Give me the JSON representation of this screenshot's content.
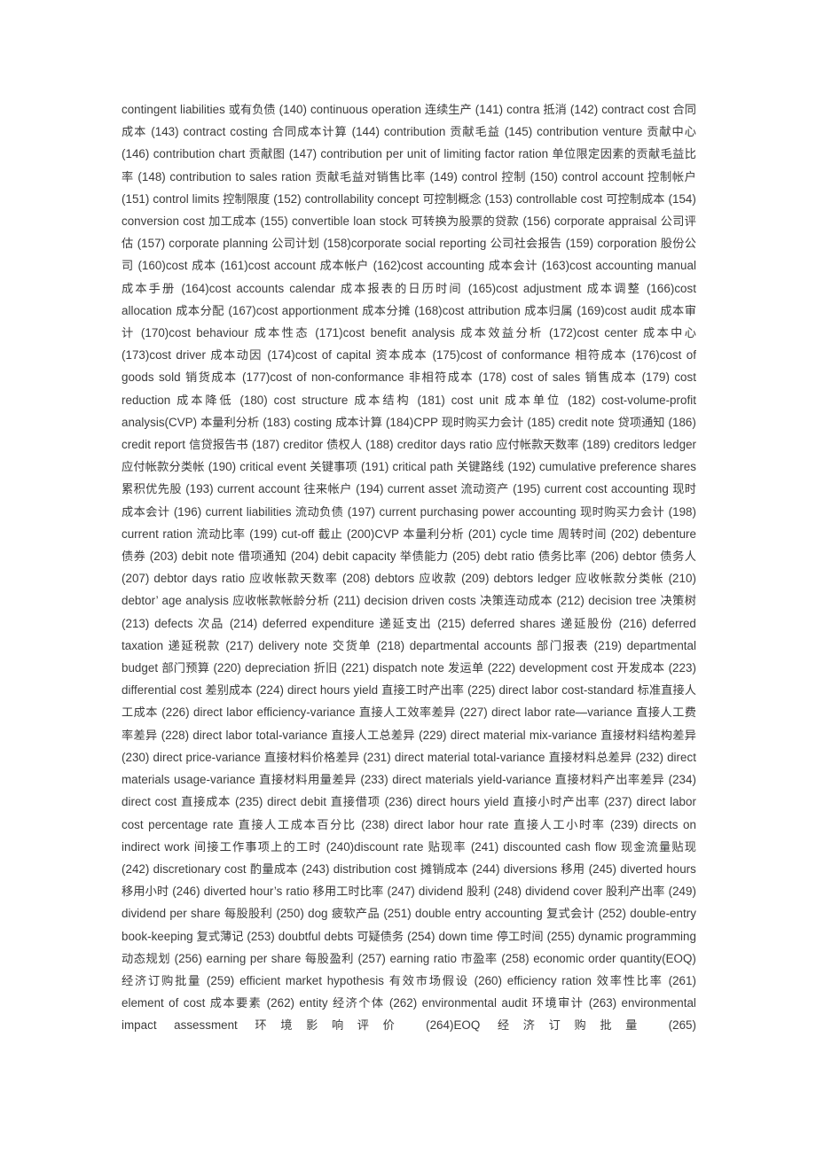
{
  "document": {
    "page_background": "#ffffff",
    "text_color": "#3b3b3b",
    "kind": "bilingual-glossary-page",
    "entry_range": "140-265",
    "entries": [
      {
        "num": "",
        "en": "contingent liabilities",
        "zh": "或有负债"
      },
      {
        "num": "(140)",
        "en": "continuous operation",
        "zh": "连续生产"
      },
      {
        "num": "(141)",
        "en": "contra",
        "zh": "抵消"
      },
      {
        "num": "(142)",
        "en": "contract cost",
        "zh": "合同成本"
      },
      {
        "num": "(143)",
        "en": "contract costing",
        "zh": "合同成本计算"
      },
      {
        "num": "(144)",
        "en": "contribution",
        "zh": "贡献毛益"
      },
      {
        "num": "(145)",
        "en": "contribution venture",
        "zh": "贡献中心"
      },
      {
        "num": "(146)",
        "en": "contribution chart",
        "zh": "贡献图"
      },
      {
        "num": "(147)",
        "en": "contribution per unit of limiting factor ration",
        "zh": "单位限定因素的贡献毛益比率"
      },
      {
        "num": "(148)",
        "en": "contribution to sales ration",
        "zh": "贡献毛益对销售比率"
      },
      {
        "num": "(149)",
        "en": "control",
        "zh": "控制"
      },
      {
        "num": "(150)",
        "en": "control account",
        "zh": "控制帐户"
      },
      {
        "num": "(151)",
        "en": "control limits",
        "zh": "控制限度"
      },
      {
        "num": "(152)",
        "en": "controllability concept",
        "zh": "可控制概念"
      },
      {
        "num": "(153)",
        "en": "controllable cost",
        "zh": "可控制成本"
      },
      {
        "num": "(154)",
        "en": "conversion cost",
        "zh": "加工成本"
      },
      {
        "num": "(155)",
        "en": "convertible loan stock",
        "zh": "可转换为股票的贷款"
      },
      {
        "num": "(156)",
        "en": "corporate appraisal",
        "zh": "公司评估"
      },
      {
        "num": "(157)",
        "en": "corporate planning",
        "zh": "公司计划"
      },
      {
        "num": "(158)",
        "en": "corporate social reporting",
        "zh": "公司社会报告",
        "tight": true
      },
      {
        "num": "(159)",
        "en": "corporation",
        "zh": "股份公司"
      },
      {
        "num": "(160)",
        "en": "cost",
        "zh": "成本",
        "tight": true
      },
      {
        "num": "(161)",
        "en": "cost account",
        "zh": "成本帐户",
        "tight": true
      },
      {
        "num": "(162)",
        "en": "cost accounting",
        "zh": "成本会计",
        "tight": true
      },
      {
        "num": "(163)",
        "en": "cost accounting manual",
        "zh": "成本手册",
        "tight": true
      },
      {
        "num": "(164)",
        "en": "cost accounts calendar",
        "zh": "成本报表的日历时间",
        "tight": true
      },
      {
        "num": "(165)",
        "en": "cost adjustment",
        "zh": "成本调整",
        "tight": true
      },
      {
        "num": "(166)",
        "en": "cost allocation",
        "zh": "成本分配",
        "tight": true
      },
      {
        "num": "(167)",
        "en": "cost apportionment",
        "zh": "成本分摊",
        "tight": true
      },
      {
        "num": "(168)",
        "en": "cost attribution",
        "zh": "成本归属",
        "tight": true
      },
      {
        "num": "(169)",
        "en": "cost audit",
        "zh": "成本审计",
        "tight": true
      },
      {
        "num": "(170)",
        "en": "cost behaviour",
        "zh": "成本性态",
        "tight": true
      },
      {
        "num": "(171)",
        "en": "cost benefit analysis",
        "zh": "成本效益分析",
        "tight": true
      },
      {
        "num": "(172)",
        "en": "cost center",
        "zh": "成本中心",
        "tight": true
      },
      {
        "num": "(173)",
        "en": "cost driver",
        "zh": "成本动因",
        "tight": true
      },
      {
        "num": "(174)",
        "en": "cost of capital",
        "zh": "资本成本",
        "tight": true
      },
      {
        "num": "(175)",
        "en": "cost of conformance",
        "zh": "相符成本",
        "tight": true
      },
      {
        "num": "(176)",
        "en": "cost of goods sold",
        "zh": "销货成本",
        "tight": true
      },
      {
        "num": "(177)",
        "en": "cost of non-conformance",
        "zh": "非相符成本",
        "tight": true
      },
      {
        "num": "(178)",
        "en": "cost of sales",
        "zh": "销售成本"
      },
      {
        "num": "(179)",
        "en": "cost reduction",
        "zh": "成本降低"
      },
      {
        "num": "(180)",
        "en": "cost structure",
        "zh": "成本结构"
      },
      {
        "num": "(181)",
        "en": "cost unit",
        "zh": "成本单位"
      },
      {
        "num": "(182)",
        "en": "cost-volume-profit analysis(CVP)",
        "zh": "本量利分析"
      },
      {
        "num": "(183)",
        "en": "costing",
        "zh": "成本计算"
      },
      {
        "num": "(184)",
        "en": "CPP",
        "zh": "现时购买力会计",
        "tight": true
      },
      {
        "num": "(185)",
        "en": "credit note",
        "zh": "贷项通知"
      },
      {
        "num": "(186)",
        "en": "credit report",
        "zh": "信贷报告书"
      },
      {
        "num": "(187)",
        "en": "creditor",
        "zh": "债权人"
      },
      {
        "num": "(188)",
        "en": "creditor days ratio",
        "zh": "应付帐款天数率"
      },
      {
        "num": "(189)",
        "en": "creditors ledger",
        "zh": "应付帐款分类帐"
      },
      {
        "num": "(190)",
        "en": "critical event",
        "zh": "关键事项"
      },
      {
        "num": "(191)",
        "en": "critical path",
        "zh": "关键路线"
      },
      {
        "num": "(192)",
        "en": "cumulative preference shares",
        "zh": "累积优先股"
      },
      {
        "num": "(193)",
        "en": "current account",
        "zh": "往来帐户"
      },
      {
        "num": "(194)",
        "en": "current asset",
        "zh": "流动资产"
      },
      {
        "num": "(195)",
        "en": "current cost accounting",
        "zh": "现时成本会计"
      },
      {
        "num": "(196)",
        "en": "current liabilities",
        "zh": "流动负债"
      },
      {
        "num": "(197)",
        "en": "current purchasing power accounting",
        "zh": "现时购买力会计"
      },
      {
        "num": "(198)",
        "en": "current ration",
        "zh": "流动比率"
      },
      {
        "num": "(199)",
        "en": "cut-off",
        "zh": "截止"
      },
      {
        "num": "(200)",
        "en": "CVP",
        "zh": "本量利分析",
        "tight": true
      },
      {
        "num": "(201)",
        "en": "cycle time",
        "zh": "周转时间"
      },
      {
        "num": "(202)",
        "en": "debenture",
        "zh": "债券"
      },
      {
        "num": "(203)",
        "en": "debit note",
        "zh": "借项通知"
      },
      {
        "num": "(204)",
        "en": "debit capacity",
        "zh": "举债能力"
      },
      {
        "num": "(205)",
        "en": "debt ratio",
        "zh": "债务比率"
      },
      {
        "num": "(206)",
        "en": "debtor",
        "zh": "债务人"
      },
      {
        "num": "(207)",
        "en": "debtor days ratio",
        "zh": "应收帐款天数率"
      },
      {
        "num": "(208)",
        "en": "debtors",
        "zh": "应收款"
      },
      {
        "num": "(209)",
        "en": "debtors ledger",
        "zh": "应收帐款分类帐"
      },
      {
        "num": "(210)",
        "en": "debtor’ age analysis",
        "zh": "应收帐款帐龄分析"
      },
      {
        "num": "(211)",
        "en": "decision driven costs",
        "zh": "决策连动成本"
      },
      {
        "num": "(212)",
        "en": "decision tree",
        "zh": "决策树"
      },
      {
        "num": "(213)",
        "en": "defects",
        "zh": "次品"
      },
      {
        "num": "(214)",
        "en": "deferred expenditure",
        "zh": "递延支出"
      },
      {
        "num": "(215)",
        "en": "deferred shares",
        "zh": "递延股份"
      },
      {
        "num": "(216)",
        "en": "deferred taxation",
        "zh": "递延税款"
      },
      {
        "num": "(217)",
        "en": "delivery note",
        "zh": "交货单"
      },
      {
        "num": "(218)",
        "en": "departmental accounts",
        "zh": "部门报表"
      },
      {
        "num": "(219)",
        "en": "departmental budget",
        "zh": "部门预算"
      },
      {
        "num": "(220)",
        "en": "depreciation",
        "zh": "折旧"
      },
      {
        "num": "(221)",
        "en": "dispatch note",
        "zh": "发运单"
      },
      {
        "num": "(222)",
        "en": "development cost",
        "zh": "开发成本"
      },
      {
        "num": "(223)",
        "en": "differential cost",
        "zh": "差别成本"
      },
      {
        "num": "(224)",
        "en": "direct hours yield",
        "zh": "直接工时产出率"
      },
      {
        "num": "(225)",
        "en": "direct labor cost-standard",
        "zh": "标准直接人工成本"
      },
      {
        "num": "(226)",
        "en": "direct labor efficiency-variance",
        "zh": "直接人工效率差异"
      },
      {
        "num": "(227)",
        "en": "direct labor rate—variance",
        "zh": "直接人工费率差异"
      },
      {
        "num": "(228)",
        "en": "direct labor total-variance",
        "zh": "直接人工总差异"
      },
      {
        "num": "(229)",
        "en": "direct material mix-variance",
        "zh": "直接材料结构差异"
      },
      {
        "num": "(230)",
        "en": "direct price-variance",
        "zh": "直接材料价格差异"
      },
      {
        "num": "(231)",
        "en": "direct material total-variance",
        "zh": "直接材料总差异"
      },
      {
        "num": "(232)",
        "en": "direct materials usage-variance",
        "zh": "直接材料用量差异"
      },
      {
        "num": "(233)",
        "en": "direct materials yield-variance",
        "zh": "直接材料产出率差异"
      },
      {
        "num": "(234)",
        "en": "direct cost",
        "zh": "直接成本"
      },
      {
        "num": "(235)",
        "en": "direct debit",
        "zh": "直接借项"
      },
      {
        "num": "(236)",
        "en": "direct hours yield",
        "zh": "直接小时产出率"
      },
      {
        "num": "(237)",
        "en": "direct labor cost percentage rate",
        "zh": "直接人工成本百分比"
      },
      {
        "num": "(238)",
        "en": "direct labor hour rate",
        "zh": "直接人工小时率"
      },
      {
        "num": "(239)",
        "en": "directs on indirect work",
        "zh": "间接工作事项上的工时"
      },
      {
        "num": "(240)",
        "en": "discount rate",
        "zh": "贴现率",
        "tight": true
      },
      {
        "num": "(241)",
        "en": "discounted cash flow",
        "zh": "现金流量贴现"
      },
      {
        "num": "(242)",
        "en": "discretionary cost",
        "zh": "酌量成本"
      },
      {
        "num": "(243)",
        "en": "distribution cost",
        "zh": "摊销成本"
      },
      {
        "num": "(244)",
        "en": "diversions",
        "zh": "移用"
      },
      {
        "num": "(245)",
        "en": "diverted hours",
        "zh": "移用小时"
      },
      {
        "num": "(246)",
        "en": "diverted hour’s ratio",
        "zh": "移用工时比率"
      },
      {
        "num": "(247)",
        "en": "dividend",
        "zh": "股利"
      },
      {
        "num": "(248)",
        "en": "dividend cover",
        "zh": "股利产出率"
      },
      {
        "num": "(249)",
        "en": "dividend per share",
        "zh": "每股股利"
      },
      {
        "num": "(250)",
        "en": "dog",
        "zh": "疲软产品"
      },
      {
        "num": "(251)",
        "en": "double entry accounting",
        "zh": "复式会计"
      },
      {
        "num": "(252)",
        "en": "double-entry book-keeping",
        "zh": "复式薄记"
      },
      {
        "num": "(253)",
        "en": "doubtful debts",
        "zh": "可疑债务"
      },
      {
        "num": "(254)",
        "en": "down time",
        "zh": "停工时间"
      },
      {
        "num": "(255)",
        "en": "dynamic programming",
        "zh": "动态规划"
      },
      {
        "num": "(256)",
        "en": "earning per share",
        "zh": "每股盈利"
      },
      {
        "num": "(257)",
        "en": "earning ratio",
        "zh": "市盈率"
      },
      {
        "num": "(258)",
        "en": "economic order quantity(EOQ)",
        "zh": "经济订购批量"
      },
      {
        "num": "(259)",
        "en": "efficient market hypothesis",
        "zh": "有效市场假设"
      },
      {
        "num": "(260)",
        "en": "efficiency ration",
        "zh": "效率性比率"
      },
      {
        "num": "(261)",
        "en": "element of cost",
        "zh": "成本要素"
      },
      {
        "num": "(262)",
        "en": "entity",
        "zh": "经济个体"
      },
      {
        "num": "(262)",
        "en": "environmental audit",
        "zh": "环境审计"
      },
      {
        "num": "(263)",
        "en": "environmental impact assessment",
        "zh": "环境影响评价"
      },
      {
        "num": "(264)",
        "en": "EOQ",
        "zh": "经济订购批量",
        "tight": true
      },
      {
        "num": "(265)",
        "en": "",
        "zh": ""
      }
    ]
  }
}
